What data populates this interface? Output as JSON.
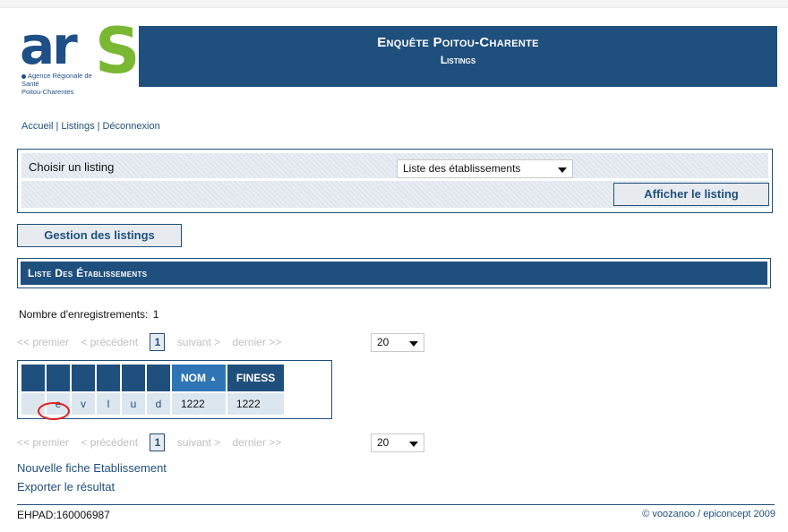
{
  "logo": {
    "text": "ar",
    "letter_s": "S",
    "sub_line1": "Agence Régionale de Santé",
    "sub_line2": "Poitou-Charentes"
  },
  "header": {
    "title": "Enquête Poitou-Charente",
    "subtitle": "Listings"
  },
  "nav": {
    "items": [
      "Accueil",
      "Listings",
      "Déconnexion"
    ]
  },
  "form": {
    "label": "Choisir un listing",
    "selected": "Liste des établissements",
    "show_button": "Afficher le listing"
  },
  "manage_button": "Gestion des listings",
  "section_title": "Liste Des Établissements",
  "record_count_label": "Nombre d'enregistrements:",
  "record_count": "1",
  "pager": {
    "first": "<< premier",
    "prev": "< précédent",
    "current": "1",
    "next": "suivant >",
    "last": "dernier >>",
    "page_size": "20"
  },
  "table": {
    "columns": [
      "",
      "",
      "",
      "",
      "",
      "",
      "NOM",
      "FINESS"
    ],
    "sorted_column": "NOM",
    "rows": [
      {
        "actions": [
          "e",
          "v",
          "l",
          "u",
          "d"
        ],
        "nom": "1222",
        "finess": "1222"
      }
    ]
  },
  "links": {
    "new_record": "Nouvelle fiche Etablissement",
    "export": "Exporter le résultat"
  },
  "footer": {
    "left": "EHPAD:160006987",
    "right": "© voozanoo / epiconcept 2009"
  },
  "colors": {
    "primary": "#1f4f7c",
    "accent_green": "#7ab733",
    "sorted_header": "#2f75b6",
    "highlight_circle": "#e02020"
  }
}
